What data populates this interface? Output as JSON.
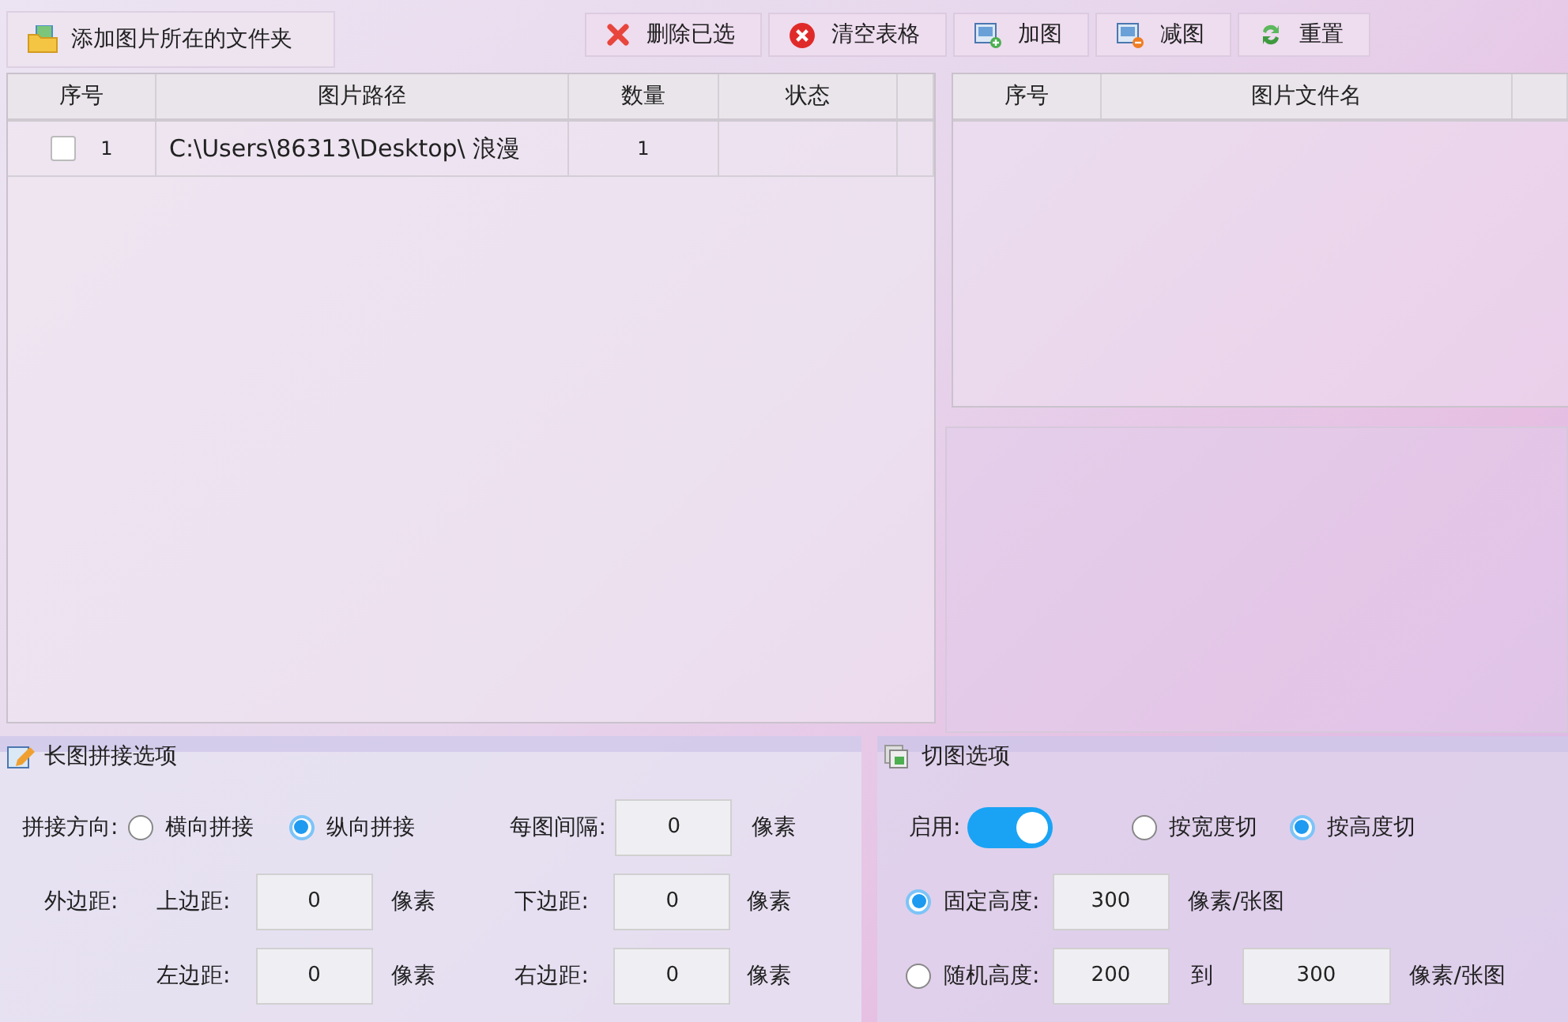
{
  "toolbar": {
    "add_folder_button": "添加图片所在的文件夹",
    "buttons": [
      {
        "label": "删除已选",
        "kind": "delete"
      },
      {
        "label": "清空表格",
        "kind": "clear"
      },
      {
        "label": "加图",
        "kind": "add"
      },
      {
        "label": "减图",
        "kind": "remove"
      },
      {
        "label": "重置",
        "kind": "reset"
      }
    ]
  },
  "left_table": {
    "columns": [
      "序号",
      "图片路径",
      "数量",
      "状态"
    ],
    "rows": [
      {
        "checked": false,
        "index": "1",
        "path": "C:\\Users\\86313\\Desktop\\ 浪漫",
        "count": "1"
      }
    ]
  },
  "right_table": {
    "columns": [
      "序号",
      "图片文件名"
    ]
  },
  "stitch_options": {
    "title": "长图拼接选项",
    "direction_label": "拼接方向:",
    "directions": [
      {
        "label": "横向拼接",
        "selected": false
      },
      {
        "label": "纵向拼接",
        "selected": true
      }
    ],
    "spacing_label": "每图间隔:",
    "spacing_value": "0",
    "spacing_unit": "像素",
    "margin_label": "外边距:",
    "margins": [
      {
        "label": "上边距:",
        "value": "0",
        "unit": "像素"
      },
      {
        "label": "下边距:",
        "value": "0",
        "unit": "像素"
      },
      {
        "label": "左边距:",
        "value": "0",
        "unit": "像素"
      },
      {
        "label": "右边距:",
        "value": "0",
        "unit": "像素"
      }
    ]
  },
  "cut_options": {
    "title": "切图选项",
    "enable_label": "启用:",
    "enabled": true,
    "modes": [
      {
        "label": "按宽度切",
        "selected": false
      },
      {
        "label": "按高度切",
        "selected": true
      }
    ],
    "fixed": {
      "selected": true,
      "label": "固定高度:",
      "value": "300",
      "unit": "像素/张图"
    },
    "random": {
      "selected": false,
      "label": "随机高度:",
      "min": "200",
      "to_label": "到",
      "max": "300",
      "unit": "像素/张图"
    }
  }
}
